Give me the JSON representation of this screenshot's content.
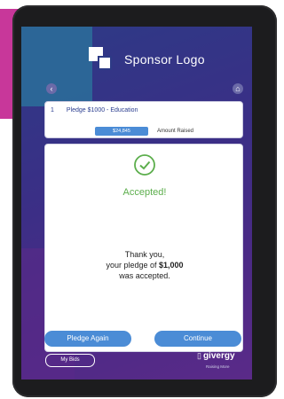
{
  "sponsor": {
    "logo_text": "Sponsor Logo"
  },
  "nav": {
    "back_icon": "chevron-left-icon",
    "home_icon": "home-icon"
  },
  "pledge": {
    "index": "1",
    "title": "Pledge $1000 - Education",
    "amount_raised_value": "$24,845",
    "amount_raised_label": "Amount Raised"
  },
  "status": {
    "accepted_label": "Accepted!",
    "thank_line1": "Thank you,",
    "thank_line2_prefix": "your pledge of ",
    "thank_amount": "$1,000",
    "thank_line3": "was accepted."
  },
  "actions": {
    "pledge_again_label": "Pledge Again",
    "continue_label": "Continue",
    "my_bids_label": "My Bids"
  },
  "brand": {
    "name": "givergy",
    "tagline": "Raising More"
  },
  "colors": {
    "accent": "#c8379a",
    "button": "#4b8cd6",
    "success": "#5cae4c",
    "background": "#3a2f86"
  }
}
